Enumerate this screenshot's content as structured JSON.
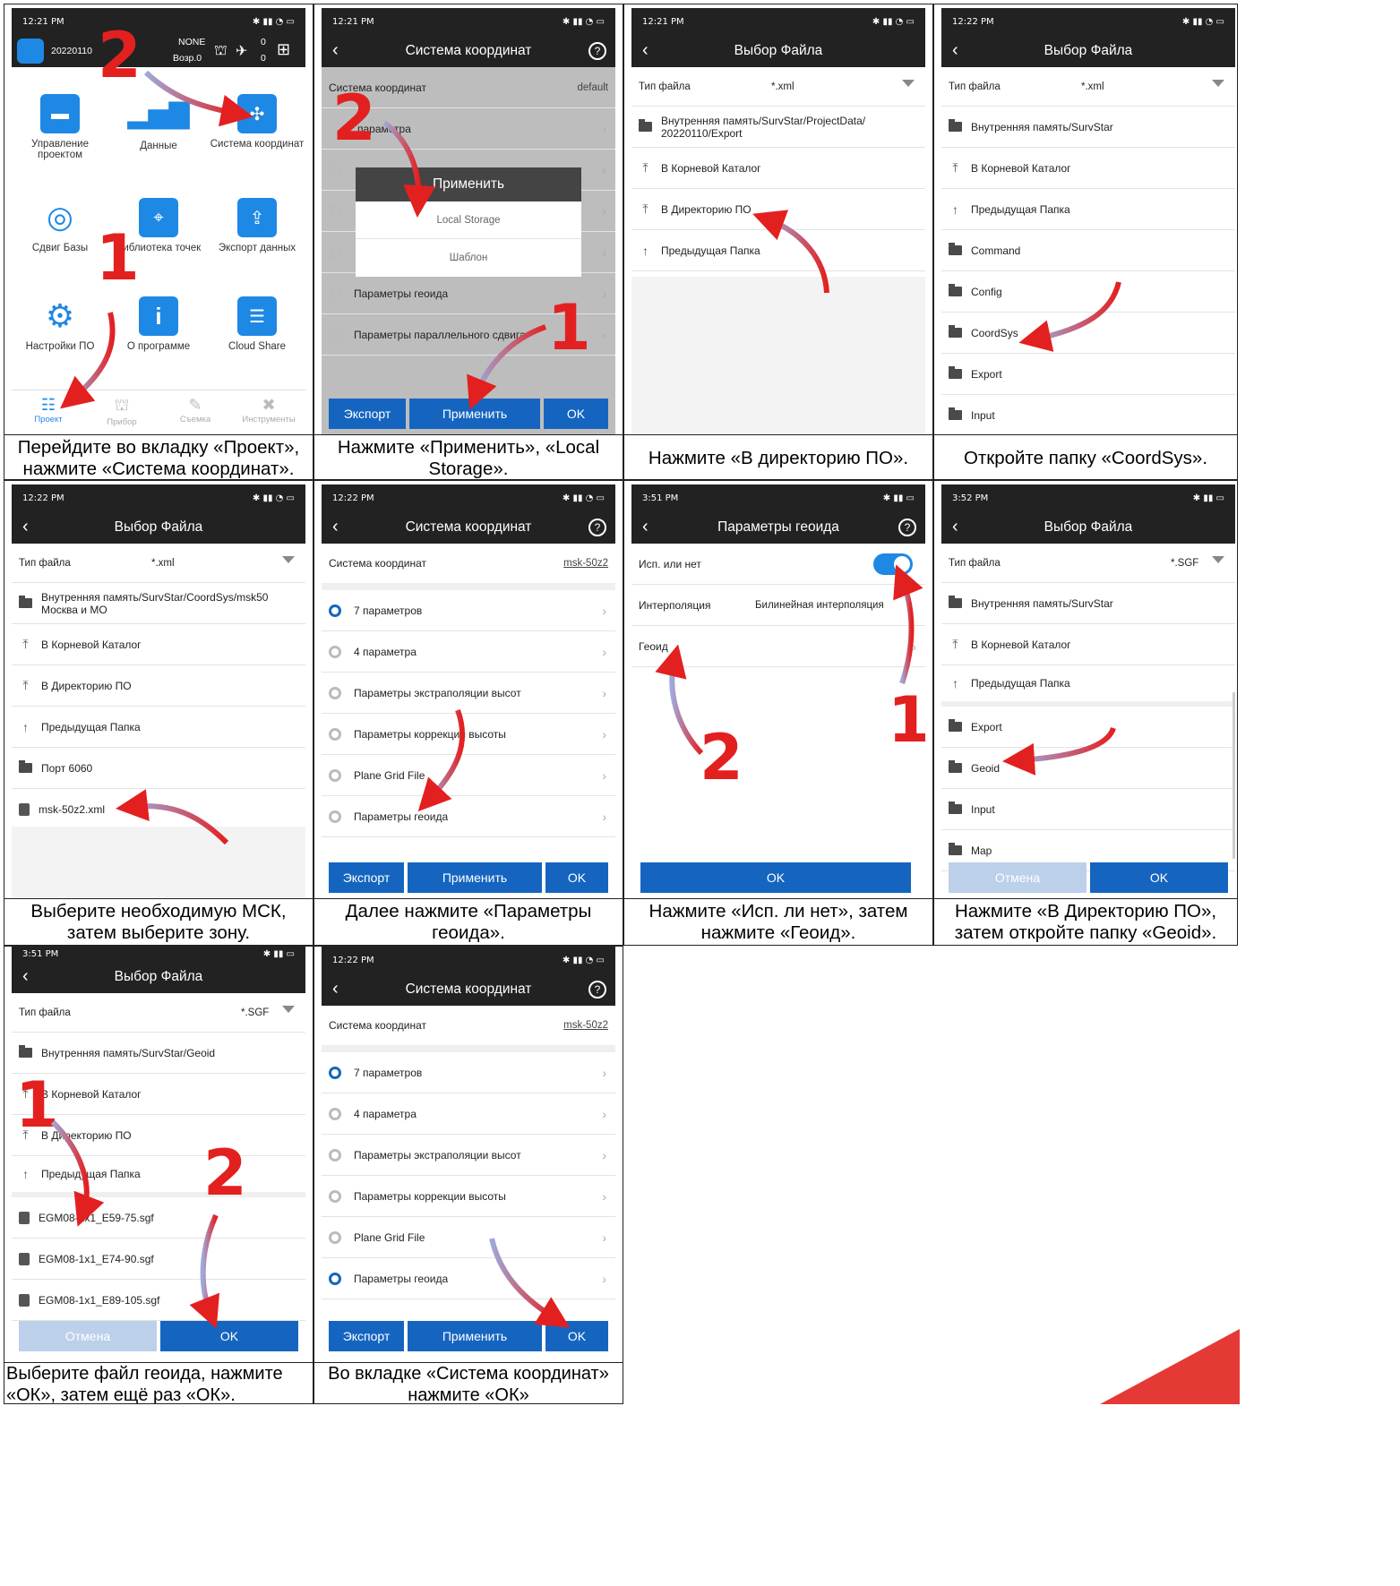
{
  "captions": [
    "Перейдите во вкладку «Проект», нажмите «Система координат».",
    "Нажмите «Применить», «Local Storage».",
    "Нажмите «В директорию ПО».",
    "Откройте папку «CoordSys».",
    "Выберите необходимую МСК, затем выберите зону.",
    "Далее нажмите «Параметры геоида».",
    "Нажмите «Исп. ли нет», затем нажмите «Геоид».",
    "Нажмите «В Директорию ПО», затем откройте папку «Geoid».",
    "Выберите файл геоида, нажмите «ОК», затем ещё раз «ОК».",
    "Во вкладке «Система координат» нажмите «ОК»"
  ],
  "status": {
    "t1221": "12:21 PM",
    "t1222": "12:22 PM",
    "t351": "3:51 PM",
    "t352": "3:52 PM"
  },
  "s1": {
    "project": "20220110",
    "none": "NONE",
    "age": "Возр.0",
    "z1": "0",
    "z2": "0",
    "items": [
      "Управление проектом",
      "Данные",
      "Система координат",
      "Сдвиг Базы",
      "Библиотека точек",
      "Экспорт данных",
      "Настройки ПО",
      "О программе",
      "Cloud Share"
    ],
    "tabs": [
      "Проект",
      "Прибор",
      "Съемка",
      "Инструменты"
    ],
    "n1": "1",
    "n2": "2"
  },
  "s2": {
    "title": "Система координат",
    "cs_label": "Система координат",
    "cs_value": "default",
    "row1": "параметра",
    "popup_title": "Применить",
    "popup_items": [
      "Local Storage",
      "Шаблон"
    ],
    "row_geoid": "Параметры геоида",
    "row_shift": "Параметры параллельного сдвига",
    "btn_export": "Экспорт",
    "btn_apply": "Применить",
    "btn_ok": "OK",
    "n1": "1",
    "n2": "2"
  },
  "s3": {
    "title": "Выбор Файла",
    "filetype_label": "Тип файла",
    "filetype_value": "*.xml",
    "path": "Внутренняя память/SurvStar/ProjectData/ 20220110/Export",
    "root": "В Корневой Каталог",
    "sw": "В Директорию ПО",
    "prev": "Предыдущая Папка"
  },
  "s4": {
    "title": "Выбор Файла",
    "filetype_label": "Тип файла",
    "filetype_value": "*.xml",
    "path": "Внутренняя память/SurvStar",
    "root": "В Корневой Каталог",
    "prev": "Предыдущая Папка",
    "folders": [
      "Command",
      "Config",
      "CoordSys",
      "Export",
      "Input"
    ]
  },
  "s5": {
    "title": "Выбор Файла",
    "filetype_label": "Тип файла",
    "filetype_value": "*.xml",
    "path": "Внутренняя память/SurvStar/CoordSys/msk50 Москва и МО",
    "root": "В Корневой Каталог",
    "sw": "В Директорию ПО",
    "prev": "Предыдущая Папка",
    "folder": "Порт 6060",
    "file": "msk-50z2.xml"
  },
  "s6": {
    "title": "Система координат",
    "cs_label": "Система координат",
    "cs_value": "msk-50z2",
    "rows": [
      "7 параметров",
      "4 параметра",
      "Параметры экстраполяции высот",
      "Параметры коррекции высоты",
      "Plane Grid File",
      "Параметры геоида"
    ],
    "btn_export": "Экспорт",
    "btn_apply": "Применить",
    "btn_ok": "OK"
  },
  "s7": {
    "title": "Параметры геоида",
    "use_label": "Исп. или нет",
    "interp_label": "Интерполяция",
    "interp_value": "Билинейная интерполяция",
    "geoid_label": "Геоид",
    "btn_ok": "OK",
    "n1": "1",
    "n2": "2"
  },
  "s8": {
    "title": "Выбор Файла",
    "filetype_label": "Тип файла",
    "filetype_value": "*.SGF",
    "path": "Внутренняя память/SurvStar",
    "root": "В Корневой Каталог",
    "prev": "Предыдущая Папка",
    "folders": [
      "Export",
      "Geoid",
      "Input",
      "Map"
    ],
    "btn_cancel": "Отмена",
    "btn_ok": "OK"
  },
  "s9": {
    "title": "Выбор Файла",
    "filetype_label": "Тип файла",
    "filetype_value": "*.SGF",
    "path": "Внутренняя память/SurvStar/Geoid",
    "root": "В Корневой Каталог",
    "sw": "В Директорию ПО",
    "prev": "Предыдущая Папка",
    "files": [
      "EGM08-1x1_E59-75.sgf",
      "EGM08-1x1_E74-90.sgf",
      "EGM08-1x1_E89-105.sgf"
    ],
    "btn_cancel": "Отмена",
    "btn_ok": "OK",
    "n1": "1",
    "n2": "2"
  },
  "s10": {
    "title": "Система координат",
    "cs_label": "Система координат",
    "cs_value": "msk-50z2",
    "rows": [
      "7 параметров",
      "4 параметра",
      "Параметры экстраполяции высот",
      "Параметры коррекции высоты",
      "Plane Grid File",
      "Параметры геоида"
    ],
    "btn_export": "Экспорт",
    "btn_apply": "Применить",
    "btn_ok": "OK"
  },
  "colors": {
    "accent": "#1565c0",
    "bar": "#222222",
    "arrow": "#e32020",
    "corner": "#e53935"
  }
}
